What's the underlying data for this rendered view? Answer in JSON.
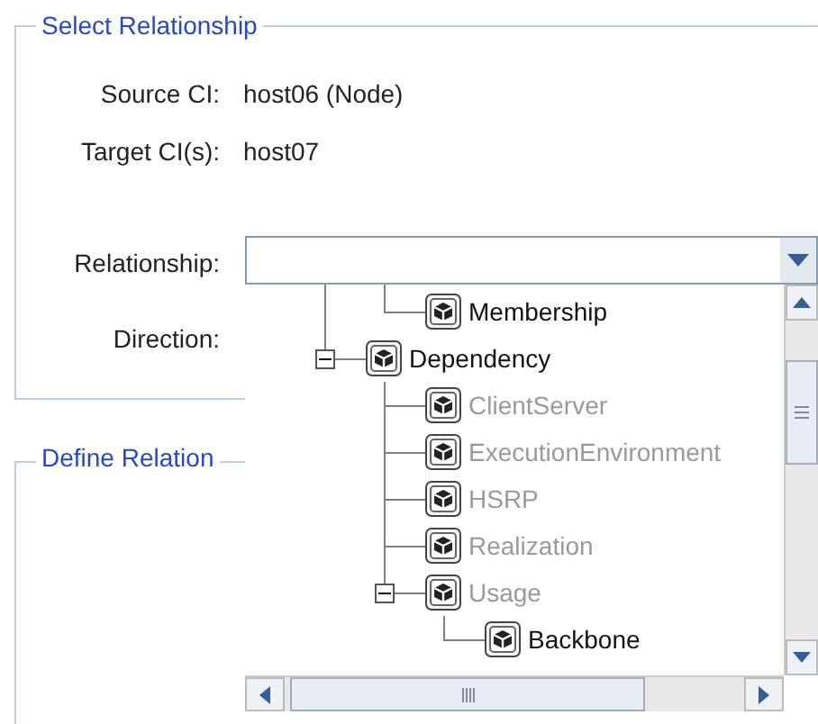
{
  "select_group": {
    "title": "Select Relationship",
    "fields": [
      {
        "label": "Source CI:",
        "value": "host06 (Node)"
      },
      {
        "label": "Target CI(s):",
        "value": "host07"
      }
    ],
    "relationship_label": "Relationship:",
    "direction_label": "Direction:"
  },
  "define_group": {
    "title": "Define Relation"
  },
  "tree": {
    "above_scroll": [
      {
        "label": "Membership",
        "disabled": false
      }
    ],
    "items": [
      {
        "label": "Dependency",
        "disabled": false,
        "expanded": true,
        "children": [
          {
            "label": "ClientServer",
            "disabled": true
          },
          {
            "label": "ExecutionEnvironment",
            "disabled": true
          },
          {
            "label": "HSRP",
            "disabled": true
          },
          {
            "label": "Realization",
            "disabled": true
          },
          {
            "label": "Usage",
            "disabled": true,
            "expanded": true,
            "children": [
              {
                "label": "Backbone",
                "disabled": false
              }
            ]
          }
        ]
      }
    ]
  }
}
